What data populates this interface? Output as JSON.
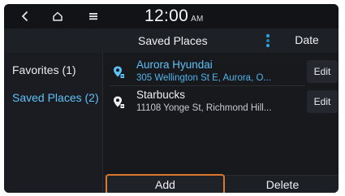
{
  "status_bar": {
    "back_icon": "chevron-left-icon",
    "home_icon": "home-icon",
    "menu_icon": "menu-icon",
    "time": "12:00",
    "ampm": "AM"
  },
  "header": {
    "title": "Saved Places",
    "options_icon": "vertical-dots-icon",
    "sort_label": "Date"
  },
  "sidebar": {
    "items": [
      {
        "label": "Favorites (1)",
        "selected": false
      },
      {
        "label": "Saved Places (2)",
        "selected": true
      }
    ]
  },
  "places": [
    {
      "name": "Aurora Hyundai",
      "address": "305 Wellington St E, Aurora, O...",
      "icon": "location-pin-icon",
      "edit_label": "Edit",
      "highlighted": true
    },
    {
      "name": "Starbucks",
      "address": "11108 Yonge St, Richmond Hill...",
      "icon": "location-pin-icon",
      "edit_label": "Edit",
      "highlighted": false
    }
  ],
  "footer": {
    "add_label": "Add",
    "delete_label": "Delete"
  },
  "colors": {
    "accent_blue": "#5ec2f7",
    "focus_orange": "#d9782f",
    "background": "#17191d"
  }
}
